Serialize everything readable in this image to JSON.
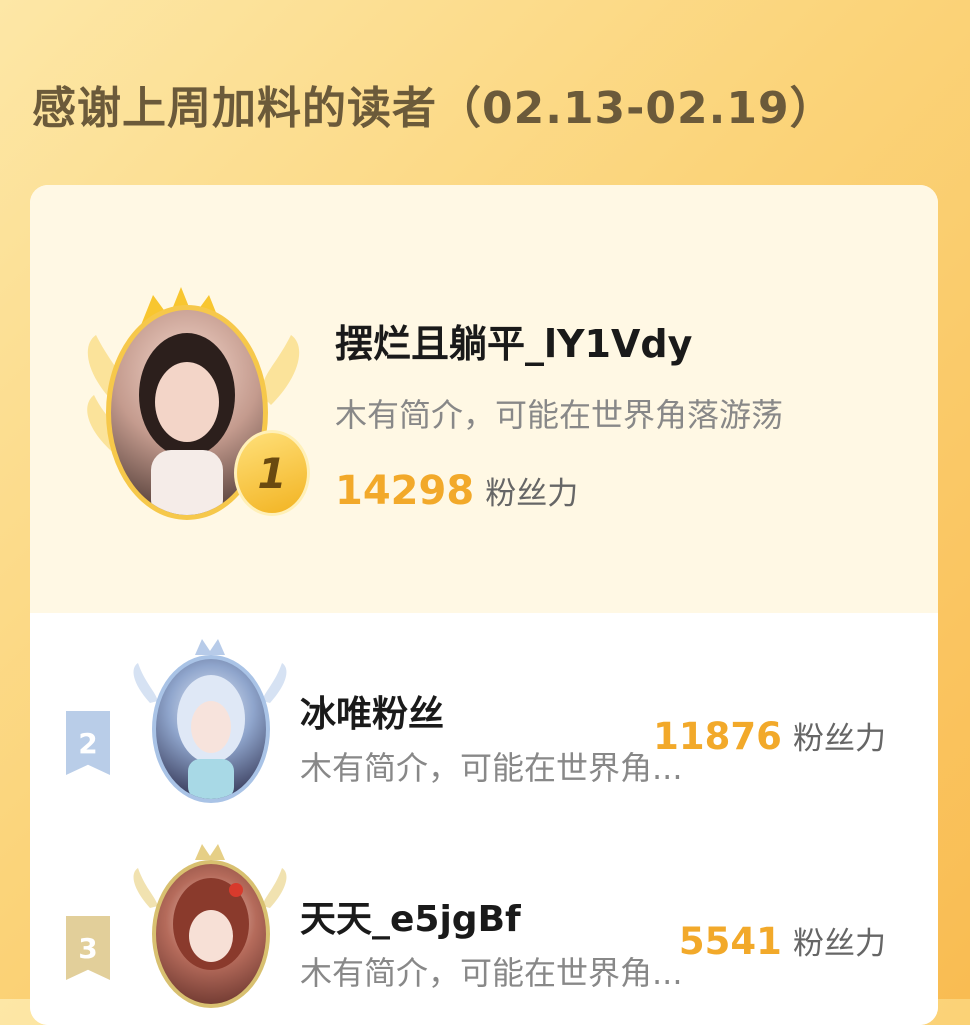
{
  "title": "感谢上周加料的读者（02.13-02.19）",
  "top_reader": {
    "rank": "1",
    "name": "摆烂且躺平_lY1Vdy",
    "bio": "木有简介，可能在世界角落游荡",
    "fans_value": "14298",
    "fans_label": "粉丝力"
  },
  "readers": [
    {
      "rank": "2",
      "name": "冰唯粉丝",
      "bio": "木有简介，可能在世界角...",
      "fans_value": "11876",
      "fans_label": "粉丝力",
      "badge_color": "#b9cde8"
    },
    {
      "rank": "3",
      "name": "天天_e5jgBf",
      "bio": "木有简介，可能在世界角...",
      "fans_value": "5541",
      "fans_label": "粉丝力",
      "badge_color": "#e2cf9a"
    }
  ],
  "colors": {
    "accent": "#f2a92a",
    "gold": "#f6c84a",
    "silver": "#a9c3e6",
    "bronze": "#d8c070"
  }
}
